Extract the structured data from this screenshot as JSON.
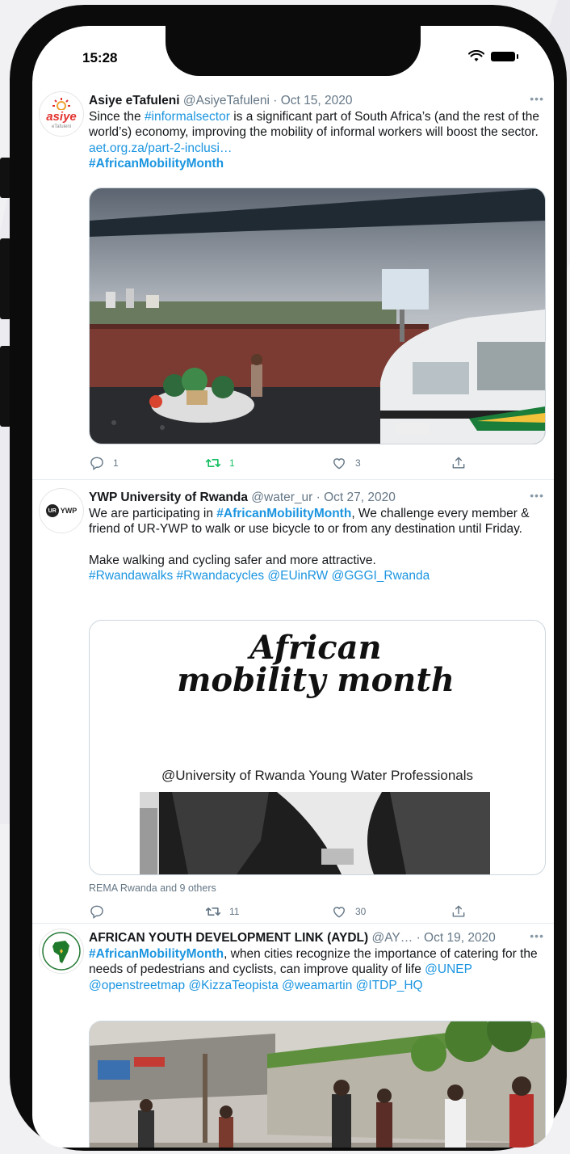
{
  "status_bar": {
    "time": "15:28"
  },
  "tweets": [
    {
      "author": "Asiye eTafuleni",
      "handle": "@AsiyeTafuleni",
      "date": "· Oct 15, 2020",
      "avatar_text": "asiye",
      "avatar_sub": "eTafuleni",
      "text_1": "Since the ",
      "link_1": "#informalsector",
      "text_2": " is a significant part of South Africa’s (and the rest of the world’s) economy, improving the mobility of informal workers will boost the sector. ",
      "link_2": "aet.org.za/part-2-inclusi…",
      "hashtag": "#AfricanMobilityMonth",
      "replies": "1",
      "retweets": "1",
      "likes": "3"
    },
    {
      "author": "YWP University of Rwanda",
      "handle": "@water_ur",
      "date": "· Oct 27, 2020",
      "avatar_text": "UR YWP",
      "text_1": "We are participating in ",
      "hashtag": "#AfricanMobilityMonth",
      "text_2": ", We challenge every member & friend of UR-YWP to walk or use bicycle to or from any destination until Friday.",
      "text_3": "Make walking and cycling safer and more attractive.",
      "tags": "#Rwandawalks #Rwandacycles @EUinRW @GGGI_Rwanda",
      "poster_title": "African mobility month",
      "poster_sub": "@University of Rwanda Young Water Professionals",
      "social": "REMA Rwanda and 9 others",
      "replies": "",
      "retweets": "11",
      "likes": "30"
    },
    {
      "author": "AFRICAN YOUTH DEVELOPMENT LINK (AYDL)",
      "handle": "@AY…",
      "date": "· Oct 19, 2020",
      "avatar_text": "AYDL",
      "hashtag": "#AfricanMobilityMonth",
      "text_1": ", when cities recognize the importance of catering for the needs of pedestrians and cyclists, can improve quality of life ",
      "mention_1": "@UNEP",
      "mentions": "@openstreetmap @KizzaTeopista @weamartin @ITDP_HQ"
    }
  ],
  "colors": {
    "link": "#1b95e0",
    "retweet_active": "#17bf63",
    "muted": "#657786"
  }
}
